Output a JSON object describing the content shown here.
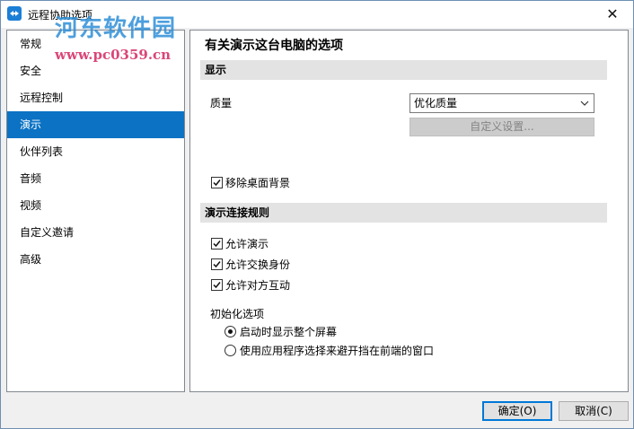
{
  "window": {
    "title": "远程协助选项",
    "close_glyph": "✕"
  },
  "watermark": {
    "line1": "河东软件园",
    "line2": "www.pc0359.cn"
  },
  "sidebar": {
    "items": [
      {
        "label": "常规",
        "selected": false
      },
      {
        "label": "安全",
        "selected": false
      },
      {
        "label": "远程控制",
        "selected": false
      },
      {
        "label": "演示",
        "selected": true
      },
      {
        "label": "伙伴列表",
        "selected": false
      },
      {
        "label": "音频",
        "selected": false
      },
      {
        "label": "视频",
        "selected": false
      },
      {
        "label": "自定义邀请",
        "selected": false
      },
      {
        "label": "高级",
        "selected": false
      }
    ]
  },
  "content": {
    "title": "有关演示这台电脑的选项",
    "display_section": {
      "header": "显示",
      "quality_label": "质量",
      "quality_value": "优化质量",
      "custom_settings_button": "自定义设置...",
      "remove_wallpaper": {
        "label": "移除桌面背景",
        "checked": true
      }
    },
    "rules_section": {
      "header": "演示连接规则",
      "options": [
        {
          "label": "允许演示",
          "checked": true
        },
        {
          "label": "允许交换身份",
          "checked": true
        },
        {
          "label": "允许对方互动",
          "checked": true
        }
      ],
      "init_label": "初始化选项",
      "radios": [
        {
          "label": "启动时显示整个屏幕",
          "checked": true
        },
        {
          "label": "使用应用程序选择来避开挡在前端的窗口",
          "checked": false
        }
      ]
    }
  },
  "footer": {
    "ok_label": "确定(O)",
    "cancel_label": "取消(C)"
  },
  "colors": {
    "accent": "#0b72c4",
    "section_header_bg": "#e3e3e3"
  }
}
